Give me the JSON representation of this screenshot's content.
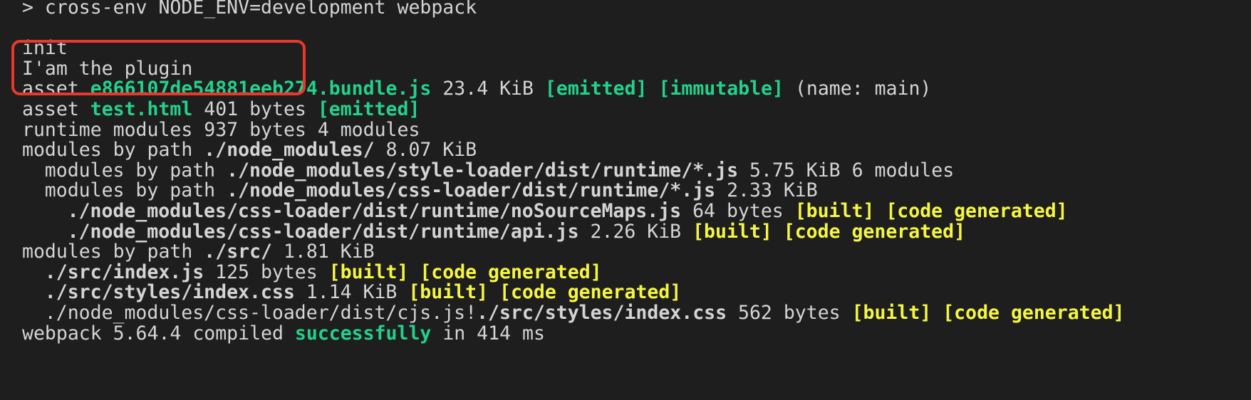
{
  "colors": {
    "background": "#1e1e1e",
    "text": "#d4d4d4",
    "success_green": "#23d18b",
    "status_yellow": "#f5f543",
    "highlight_red": "#e8382b"
  },
  "terminal": {
    "lines": [
      {
        "indent": "",
        "segments": [
          {
            "text": "> cross-env NODE_ENV=development webpack",
            "style": "plain"
          }
        ]
      },
      {
        "indent": "",
        "segments": []
      },
      {
        "indent": "",
        "segments": [
          {
            "text": "init",
            "style": "plain"
          }
        ]
      },
      {
        "indent": "",
        "segments": [
          {
            "text": "I'am the plugin",
            "style": "plain"
          }
        ]
      },
      {
        "indent": "",
        "segments": [
          {
            "text": "asset ",
            "style": "plain"
          },
          {
            "text": "e866107de54881eeb274.bundle.js",
            "style": "green"
          },
          {
            "text": " 23.4 KiB ",
            "style": "plain"
          },
          {
            "text": "[emitted]",
            "style": "green"
          },
          {
            "text": " ",
            "style": "plain"
          },
          {
            "text": "[immutable]",
            "style": "green"
          },
          {
            "text": " (name: main)",
            "style": "plain"
          }
        ]
      },
      {
        "indent": "",
        "segments": [
          {
            "text": "asset ",
            "style": "plain"
          },
          {
            "text": "test.html",
            "style": "green"
          },
          {
            "text": " 401 bytes ",
            "style": "plain"
          },
          {
            "text": "[emitted]",
            "style": "green"
          }
        ]
      },
      {
        "indent": "",
        "segments": [
          {
            "text": "runtime modules 937 bytes 4 modules",
            "style": "plain"
          }
        ]
      },
      {
        "indent": "",
        "segments": [
          {
            "text": "modules by path ",
            "style": "plain"
          },
          {
            "text": "./node_modules/",
            "style": "bold"
          },
          {
            "text": " 8.07 KiB",
            "style": "plain"
          }
        ]
      },
      {
        "indent": "  ",
        "segments": [
          {
            "text": "modules by path ",
            "style": "plain"
          },
          {
            "text": "./node_modules/style-loader/dist/runtime/*.js",
            "style": "bold"
          },
          {
            "text": " 5.75 KiB 6 modules",
            "style": "plain"
          }
        ]
      },
      {
        "indent": "  ",
        "segments": [
          {
            "text": "modules by path ",
            "style": "plain"
          },
          {
            "text": "./node_modules/css-loader/dist/runtime/*.js",
            "style": "bold"
          },
          {
            "text": " 2.33 KiB",
            "style": "plain"
          }
        ]
      },
      {
        "indent": "    ",
        "segments": [
          {
            "text": "./node_modules/css-loader/dist/runtime/noSourceMaps.js",
            "style": "bold"
          },
          {
            "text": " 64 bytes ",
            "style": "plain"
          },
          {
            "text": "[built]",
            "style": "yellow"
          },
          {
            "text": " ",
            "style": "plain"
          },
          {
            "text": "[code generated]",
            "style": "yellow"
          }
        ]
      },
      {
        "indent": "    ",
        "segments": [
          {
            "text": "./node_modules/css-loader/dist/runtime/api.js",
            "style": "bold"
          },
          {
            "text": " 2.26 KiB ",
            "style": "plain"
          },
          {
            "text": "[built]",
            "style": "yellow"
          },
          {
            "text": " ",
            "style": "plain"
          },
          {
            "text": "[code generated]",
            "style": "yellow"
          }
        ]
      },
      {
        "indent": "",
        "segments": [
          {
            "text": "modules by path ",
            "style": "plain"
          },
          {
            "text": "./src/",
            "style": "bold"
          },
          {
            "text": " 1.81 KiB",
            "style": "plain"
          }
        ]
      },
      {
        "indent": "  ",
        "segments": [
          {
            "text": "./src/index.js",
            "style": "bold"
          },
          {
            "text": " 125 bytes ",
            "style": "plain"
          },
          {
            "text": "[built]",
            "style": "yellow"
          },
          {
            "text": " ",
            "style": "plain"
          },
          {
            "text": "[code generated]",
            "style": "yellow"
          }
        ]
      },
      {
        "indent": "  ",
        "segments": [
          {
            "text": "./src/styles/index.css",
            "style": "bold"
          },
          {
            "text": " 1.14 KiB ",
            "style": "plain"
          },
          {
            "text": "[built]",
            "style": "yellow"
          },
          {
            "text": " ",
            "style": "plain"
          },
          {
            "text": "[code generated]",
            "style": "yellow"
          }
        ]
      },
      {
        "indent": "  ",
        "segments": [
          {
            "text": "./node_modules/css-loader/dist/cjs.js!",
            "style": "plain"
          },
          {
            "text": "./src/styles/index.css",
            "style": "bold"
          },
          {
            "text": " 562 bytes ",
            "style": "plain"
          },
          {
            "text": "[built]",
            "style": "yellow"
          },
          {
            "text": " ",
            "style": "plain"
          },
          {
            "text": "[code generated]",
            "style": "yellow"
          }
        ]
      },
      {
        "indent": "",
        "segments": [
          {
            "text": "webpack 5.64.4 compiled ",
            "style": "plain"
          },
          {
            "text": "successfully",
            "style": "green"
          },
          {
            "text": " in 414 ms",
            "style": "plain"
          }
        ]
      }
    ]
  }
}
